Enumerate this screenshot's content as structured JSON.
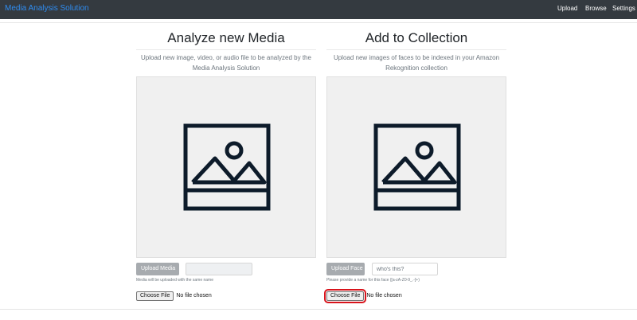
{
  "navbar": {
    "brand": "Media Analysis Solution",
    "links": [
      "Upload",
      "Browse",
      "Settings"
    ]
  },
  "analyze": {
    "title": "Analyze new Media",
    "description": "Upload new image, video, or audio file to be analyzed by the Media Analysis Solution",
    "upload_button": "Upload Media",
    "help_text": "Media will be uploaded with the same name",
    "choose_file": "Choose File",
    "file_status": "No file chosen"
  },
  "collection": {
    "title": "Add to Collection",
    "description": "Upload new images of faces to be indexed in your Amazon Rekognition collection",
    "upload_button": "Upload Face",
    "name_placeholder": "who's this?",
    "help_text": "Please provide a name for this face ([a-zA-Z0-9_.-]+)",
    "choose_file": "Choose File",
    "file_status": "No file chosen"
  },
  "icons": {
    "preview": "image-placeholder-icon"
  },
  "colors": {
    "navbar_bg": "#343a40",
    "brand": "#2f8cf0",
    "button_disabled": "#a7abaf",
    "highlight": "#d8141c",
    "preview_bg": "#f0f0f0",
    "icon_stroke": "#0d1b2a"
  }
}
